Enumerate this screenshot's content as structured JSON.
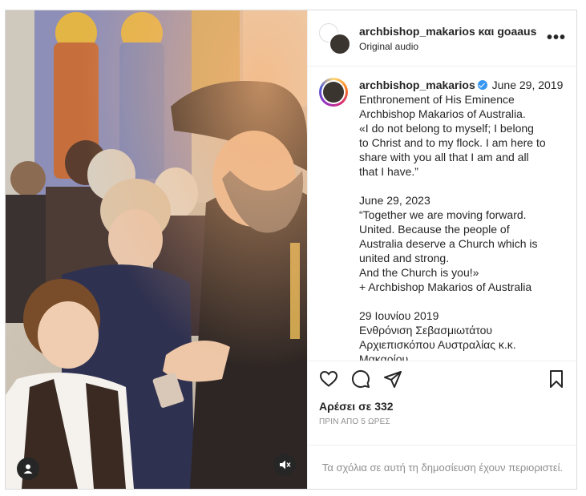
{
  "header": {
    "names": "archbishop_makarios και goaaus",
    "audio": "Original audio",
    "more_icon": "more-horizontal-icon"
  },
  "caption": {
    "username": "archbishop_makarios",
    "date": "June 29, 2019",
    "lines": [
      "Enthronement of His Eminence",
      "Archbishop Makarios of Australia.",
      "«I do not belong to myself; I belong",
      "to Christ and to my flock. I am here to",
      "share with you all that I am and all",
      "that I have.”",
      "",
      "June 29, 2023",
      "“Together we are moving forward.",
      "United. Because the people of",
      "Australia deserve a Church which is",
      "united and strong.",
      "And the Church is you!»",
      "+ Archbishop Makarios of Australia",
      "",
      "29 Ιουνίου 2019",
      "Ενθρόνιση Σεβασμιωτάτου",
      "Αρχιεπισκόπου Αυστραλίας κ.κ.",
      "Μακαρίου."
    ]
  },
  "actions": {
    "like_icon": "heart-icon",
    "comment_icon": "comment-icon",
    "share_icon": "send-icon",
    "save_icon": "bookmark-icon"
  },
  "likes": "Αρέσει σε 332",
  "time_ago": "ΠΡΙΝ ΑΠΟ 5 ΩΡΕΣ",
  "comments_note": "Τα σχόλια σε αυτή τη δημοσίευση έχουν περιοριστεί.",
  "media": {
    "tag_icon": "user-tag-icon",
    "mute_icon": "speaker-muted-icon"
  }
}
